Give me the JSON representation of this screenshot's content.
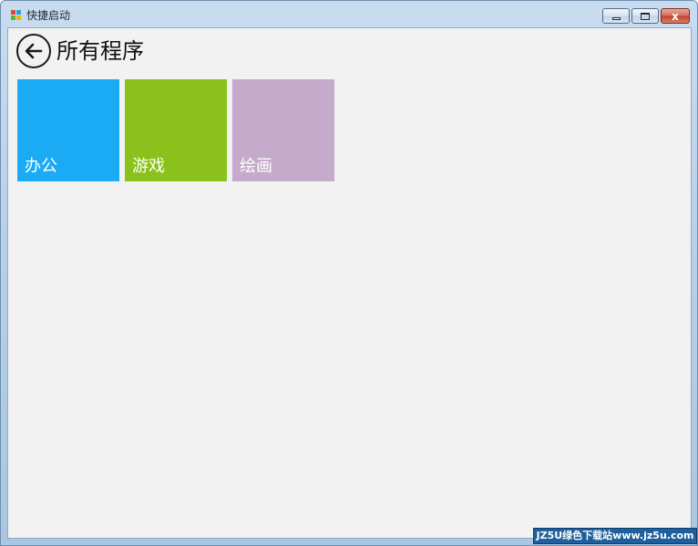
{
  "window": {
    "title": "快捷启动",
    "icon": "app-grid-icon",
    "close_glyph": "x",
    "icon_colors": [
      "#e8452c",
      "#2a9be0",
      "#5fb336",
      "#f0b400"
    ]
  },
  "header": {
    "back_icon": "arrow-left-icon",
    "title": "所有程序"
  },
  "tiles": [
    {
      "label": "办公",
      "color": "#1babf4"
    },
    {
      "label": "游戏",
      "color": "#8ac21b"
    },
    {
      "label": "绘画",
      "color": "#c5aacb"
    }
  ],
  "watermark": {
    "text": "JZ5U绿色下载站www.jz5u.com"
  }
}
